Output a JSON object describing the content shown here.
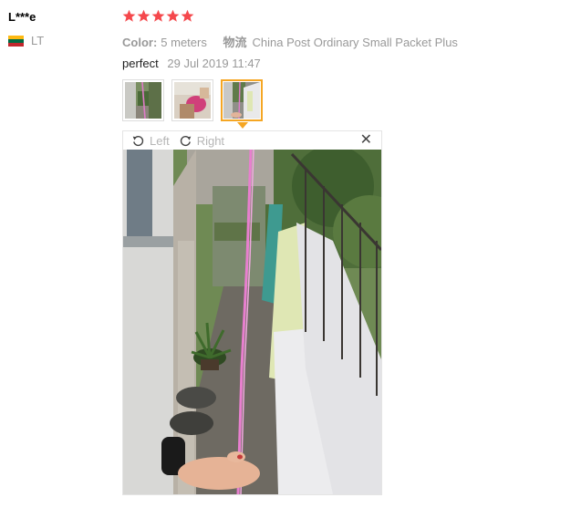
{
  "review": {
    "user_name": "L***e",
    "country_code": "LT",
    "rating": 5,
    "color_label": "Color:",
    "color_value": "5 meters",
    "shipping_label": "物流",
    "shipping_value": "China Post Ordinary Small Packet Plus",
    "text": "perfect",
    "date": "29 Jul 2019 11:47"
  },
  "viewer": {
    "rotate_left_label": "Left",
    "rotate_right_label": "Right",
    "close_label": "✕"
  },
  "colors": {
    "star": "#f5484c",
    "accent": "#f5a623",
    "flag_top": "#fdb913",
    "flag_middle": "#006a44",
    "flag_bottom": "#c1272d"
  },
  "thumbnails": [
    {
      "active": false
    },
    {
      "active": false
    },
    {
      "active": true
    }
  ]
}
